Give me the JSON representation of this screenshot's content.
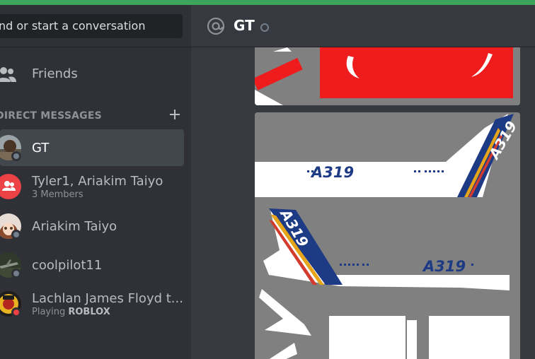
{
  "window": {
    "accent_color": "#3ba55c"
  },
  "search": {
    "text": "nd or start a conversation"
  },
  "friends": {
    "label": "Friends",
    "icon": "friends-icon"
  },
  "direct_messages": {
    "header": "DIRECT MESSAGES",
    "add_icon": "plus-icon",
    "items": [
      {
        "name": "GT",
        "status": "offline",
        "active": true
      },
      {
        "name": "Tyler1, Ariakim Taiyo",
        "subtitle": "3 Members",
        "group": true
      },
      {
        "name": "Ariakim Taiyo",
        "status": "offline"
      },
      {
        "name": "coolpilot11",
        "status": "offline"
      },
      {
        "name": "Lachlan James Floyd t...",
        "activity_prefix": "Playing ",
        "activity_name": "ROBLOX",
        "status": "dnd"
      }
    ]
  },
  "channel": {
    "name": "GT",
    "icon": "at-icon",
    "status": "offline"
  },
  "attachments": {
    "livery_text_1": "A319",
    "livery_text_2": "A319",
    "livery_text_3": "A319",
    "livery_text_4": "A319"
  },
  "colors": {
    "offline": "#747f8d",
    "dnd": "#ed4245",
    "group_avatar": "#ed4245",
    "livery_blue": "#1d3a84",
    "livery_red": "#ee1c1c"
  }
}
